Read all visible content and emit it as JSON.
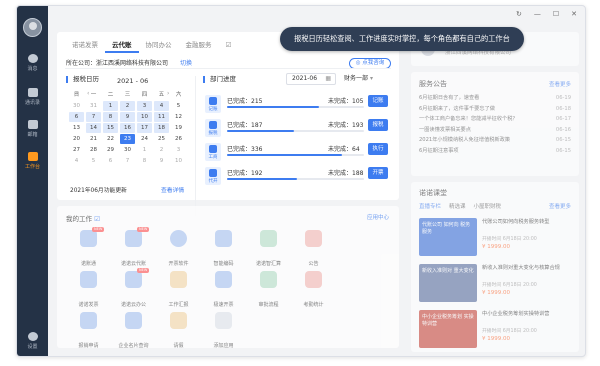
{
  "window_controls": [
    "↻",
    "—",
    "☐",
    "✕"
  ],
  "sidebar": {
    "items": [
      {
        "label": "消息",
        "icon": "message-icon"
      },
      {
        "label": "通讯录",
        "icon": "contacts-icon"
      },
      {
        "label": "邮箱",
        "icon": "mail-icon"
      },
      {
        "label": "工作台",
        "icon": "workbench-icon",
        "active": true
      }
    ],
    "settings_label": "设置"
  },
  "banner": "报税日历轻松查阅、工作进度实时掌控，每个角色都有自己的工作台",
  "tabs": [
    "诺诺发票",
    "云代账",
    "协同办公",
    "金融服务",
    "☑"
  ],
  "location": {
    "label": "所在公司：",
    "company": "浙江西溪网络科技有限公司",
    "switch": "切换",
    "consult": "点我咨询"
  },
  "calendar": {
    "title": "报税日历",
    "month": "2021 - 06",
    "prev": "‹",
    "prev2": "«",
    "next": "›",
    "next2": "»",
    "weekdays": [
      "日",
      "一",
      "二",
      "三",
      "四",
      "五",
      "六"
    ],
    "days": [
      "30",
      "31",
      "1",
      "2",
      "3",
      "4",
      "5",
      "6",
      "7",
      "8",
      "9",
      "10",
      "11",
      "12",
      "13",
      "14",
      "15",
      "16",
      "17",
      "18",
      "19",
      "20",
      "21",
      "22",
      "23",
      "24",
      "25",
      "26",
      "27",
      "28",
      "29",
      "30",
      "1",
      "2",
      "3",
      "4",
      "5",
      "6",
      "7",
      "8",
      "9",
      "10"
    ],
    "footer": "2021年06月功能更新",
    "link": "查看详情"
  },
  "progress": {
    "title": "部门进度",
    "date": "2021-06",
    "dept": "财务一部",
    "rows": [
      {
        "icon_label": "记账",
        "done": "已完成：215",
        "undone": "未完成：105",
        "btn": "记账",
        "ratio": 0.67
      },
      {
        "icon_label": "报税",
        "done": "已完成：187",
        "undone": "未完成：193",
        "btn": "报税",
        "ratio": 0.49
      },
      {
        "icon_label": "工商",
        "done": "已完成：336",
        "undone": "未完成：64",
        "btn": "执行",
        "ratio": 0.84
      },
      {
        "icon_label": "代开",
        "done": "已完成：192",
        "undone": "未完成：188",
        "btn": "开票",
        "ratio": 0.51
      }
    ]
  },
  "work": {
    "title": "我的工作",
    "edit_icon": "☑",
    "link": "应用中心",
    "apps": [
      {
        "label": "诺账通",
        "tag": "NEW"
      },
      {
        "label": "诺诺云代账",
        "tag": "NEW"
      },
      {
        "label": "开票软件",
        "tag": ""
      },
      {
        "label": "智能编码",
        "tag": ""
      },
      {
        "label": "诺诺智汇算",
        "tag": ""
      },
      {
        "label": "公告",
        "tag": ""
      },
      {
        "label": "",
        "tag": ""
      },
      {
        "label": "诺诺发票",
        "tag": ""
      },
      {
        "label": "诺诺云办公",
        "tag": "NEW"
      },
      {
        "label": "工作汇报",
        "tag": ""
      },
      {
        "label": "极速开票",
        "tag": ""
      },
      {
        "label": "审批流程",
        "tag": ""
      },
      {
        "label": "考勤统计",
        "tag": ""
      },
      {
        "label": "",
        "tag": ""
      },
      {
        "label": "报销申请",
        "tag": ""
      },
      {
        "label": "企业名片查询",
        "tag": ""
      },
      {
        "label": "请假",
        "tag": ""
      },
      {
        "label": "添加应用",
        "tag": ""
      }
    ]
  },
  "user": {
    "name": "浙江西溪网络科技有限公司"
  },
  "notice": {
    "title": "服务公告",
    "more": "查看更多",
    "items": [
      {
        "text": "6月征期日含有了，速查看",
        "date": "06-19"
      },
      {
        "text": "6月征期来了，这件事千要忘了做",
        "date": "06-18"
      },
      {
        "text": "一个体工商户备忘来！您能减半征收个税？",
        "date": "06-17"
      },
      {
        "text": "一图读懂发票相关要点",
        "date": "06-16"
      },
      {
        "text": "2021年小规模纳税人免征增值税新政策",
        "date": "06-15"
      },
      {
        "text": "6月征期注意事项",
        "date": "06-15"
      }
    ]
  },
  "classroom": {
    "title": "诺诺课堂",
    "tabs": [
      "直播专栏",
      "精选课",
      "小屋职财税"
    ],
    "more": "查看更多",
    "courses": [
      {
        "thumb": "代账公司 如何向 税务服务",
        "title": "代账公司如何向税务服务转型",
        "date": "开播时间 6月18日 20:00",
        "price": "¥ 1999.00"
      },
      {
        "thumb": "新收入准则对 重大变化",
        "title": "新收入准则对重大变化与核算合规",
        "date": "开播时间 6月18日 20:00",
        "price": "¥ 1999.00"
      },
      {
        "thumb": "中小企业税务筹划 实操特训营",
        "title": "中小企业税务筹划实操特训营",
        "date": "开播时间 6月18日 20:00",
        "price": "¥ 1999.00"
      }
    ]
  }
}
